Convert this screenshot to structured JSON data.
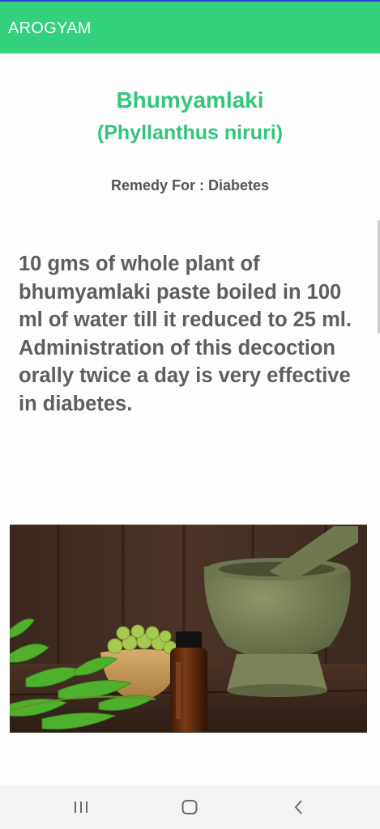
{
  "app_bar": {
    "title": "AROGYAM"
  },
  "plant": {
    "name": "Bhumyamlaki",
    "scientific_name": "(Phyllanthus niruri)",
    "remedy_label": "Remedy For : Diabetes",
    "description": "10 gms of whole plant of bhumyamlaki paste boiled in 100 ml of water till it reduced to 25 ml. Administration of this decoction orally twice a day is very effective in diabetes."
  },
  "colors": {
    "app_bar": "#33d17e",
    "accent_text": "#33c67a",
    "body_text": "#5e5e5e",
    "nav_bar": "#f4f4f6"
  },
  "photo": {
    "icon": "herbal-photo"
  },
  "nav_bar": {
    "icons": [
      "recents-icon",
      "home-icon",
      "back-icon"
    ]
  }
}
